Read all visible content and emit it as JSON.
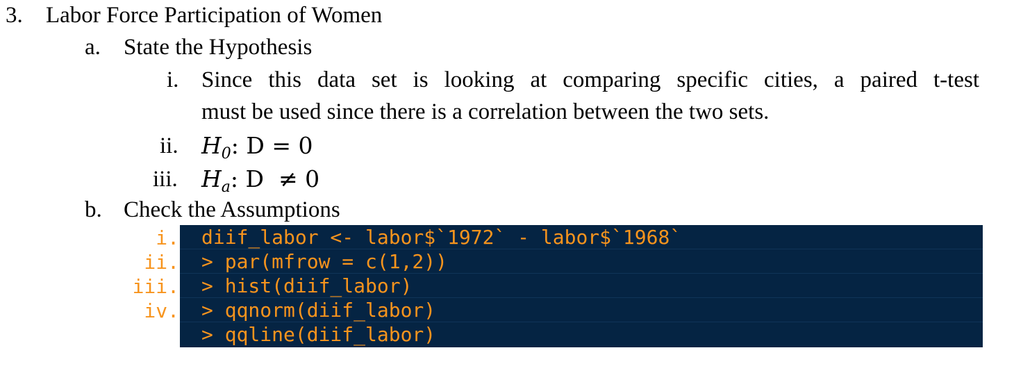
{
  "heading": {
    "number": "3.",
    "title": "Labor Force Participation of Women"
  },
  "section_a": {
    "marker": "a.",
    "title": "State the Hypothesis",
    "items": [
      {
        "marker": "i.",
        "line1": "Since this data set is looking at comparing specific cities, a paired t-test",
        "line2": "must be used since there is a correlation between the two sets."
      },
      {
        "marker": "ii.",
        "H": "H",
        "sub": "0",
        "rest": ": D = 0"
      },
      {
        "marker": "iii.",
        "H": "H",
        "sub": "a",
        "rest": ": D  ≠ 0"
      }
    ]
  },
  "section_b": {
    "marker": "b.",
    "title": "Check the Assumptions",
    "code_markers": [
      "i.",
      "ii.",
      "iii.",
      "iv."
    ],
    "code_lines": [
      "diif_labor <- labor$`1972` - labor$`1968`",
      "> par(mfrow = c(1,2))",
      "> hist(diif_labor)",
      "> qqnorm(diif_labor)",
      "> qqline(diif_labor)"
    ]
  },
  "colors": {
    "code_background": "#052443",
    "code_text": "#f7941d"
  }
}
